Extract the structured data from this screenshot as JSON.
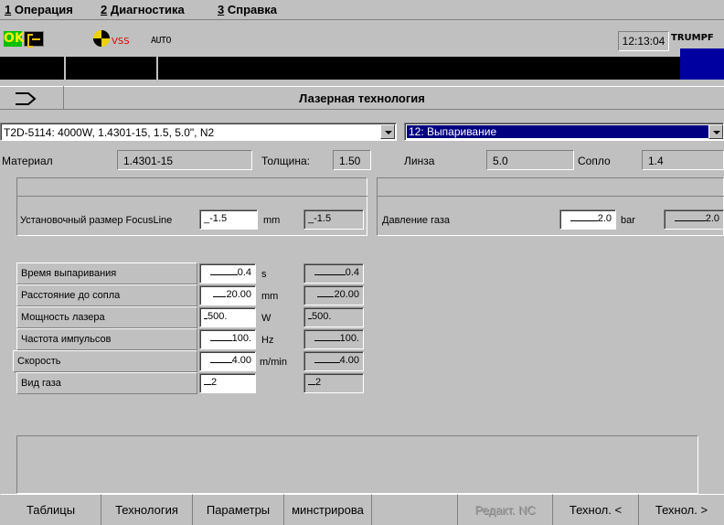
{
  "menu": [
    {
      "num": "1",
      "label": " Операция"
    },
    {
      "num": "2",
      "label": " Диагностика"
    },
    {
      "num": "3",
      "label": " Справка"
    }
  ],
  "status": {
    "ok_label": "OK",
    "vss_label": "VSS",
    "mode_label": "AUTO",
    "time": "12:13:04",
    "brand": "TRUMPF"
  },
  "title": "Лазерная технология",
  "combo_left": "T2D-5114:  4000W,  1.4301-15,  1.5,  5.0\", N2",
  "combo_right": "12: Выпаривание",
  "info": {
    "material_label": "Материал",
    "material_value": "1.4301-15",
    "thickness_label": "Толщина:",
    "thickness_value": "1.50",
    "lens_label": "Линза",
    "lens_value": "5.0",
    "nozzle_label": "Сопло",
    "nozzle_value": "1.4"
  },
  "focus": {
    "label": "Установочный размер FocusLine",
    "value": "-1.5",
    "unit": "mm",
    "readout": "-1.5"
  },
  "gas_pressure": {
    "label": "Давление газа",
    "value": "2.0",
    "unit": "bar",
    "readout": "2.0"
  },
  "params": [
    {
      "label": "Время выпаривания",
      "value": "0.4",
      "unit": "s",
      "readout": "0.4"
    },
    {
      "label": "Расстояние до сопла",
      "value": "20.00",
      "unit": "mm",
      "readout": "20.00"
    },
    {
      "label": "Мощность лазера",
      "value": "500.",
      "unit": "W",
      "readout": "500."
    },
    {
      "label": "Частота импульсов",
      "value": "100.",
      "unit": "Hz",
      "readout": "100."
    },
    {
      "label": "Скорость",
      "value": "4.00",
      "unit": "m/min",
      "readout": "4.00"
    },
    {
      "label": "Вид газа",
      "value": "2",
      "unit": "",
      "readout": "2"
    }
  ],
  "tabs": [
    {
      "label": "Таблицы"
    },
    {
      "label": "Технология"
    },
    {
      "label": "Параметры"
    },
    {
      "label": "минстрирова"
    },
    {
      "label": ""
    },
    {
      "label": "Редакт. NC"
    },
    {
      "label": "Технол. <"
    },
    {
      "label": "Технол. >"
    }
  ],
  "colors": {
    "ok_green": "#00c000",
    "selection_blue": "#000080",
    "brand_blue": "#0000a0",
    "vss_red": "#e00000"
  }
}
